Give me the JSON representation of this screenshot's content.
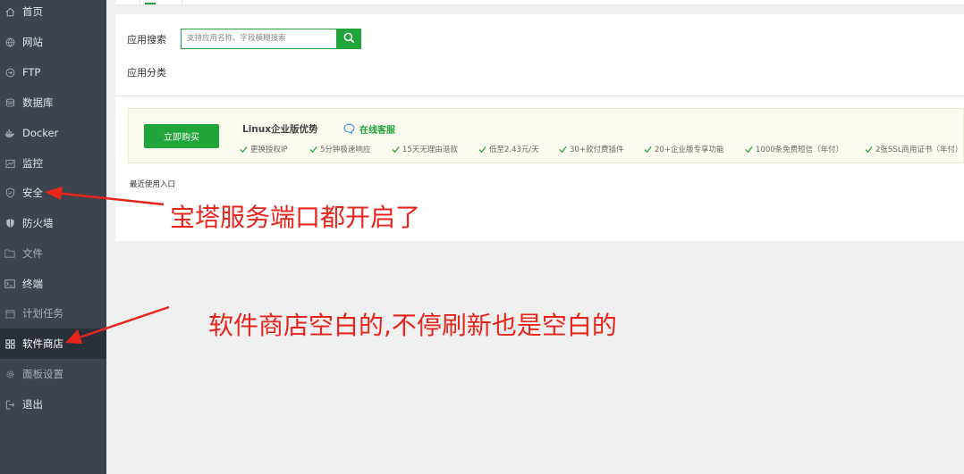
{
  "sidebar": {
    "items": [
      {
        "label": "首页",
        "icon": "home-icon"
      },
      {
        "label": "网站",
        "icon": "globe-icon"
      },
      {
        "label": "FTP",
        "icon": "ftp-icon"
      },
      {
        "label": "数据库",
        "icon": "database-icon"
      },
      {
        "label": "Docker",
        "icon": "docker-icon"
      },
      {
        "label": "监控",
        "icon": "monitor-icon"
      },
      {
        "label": "安全",
        "icon": "shield-icon"
      },
      {
        "label": "防火墙",
        "icon": "firewall-icon"
      },
      {
        "label": "文件",
        "icon": "folder-icon"
      },
      {
        "label": "终端",
        "icon": "terminal-icon"
      },
      {
        "label": "计划任务",
        "icon": "calendar-icon"
      },
      {
        "label": "软件商店",
        "icon": "grid-icon"
      },
      {
        "label": "面板设置",
        "icon": "gear-icon"
      },
      {
        "label": "退出",
        "icon": "logout-icon"
      }
    ],
    "active_index": 11
  },
  "search": {
    "label": "应用搜索",
    "placeholder": "支持应用名称、字段模糊搜索"
  },
  "category": {
    "label": "应用分类"
  },
  "promo": {
    "buy_label": "立即购买",
    "title": "Linux企业版优势",
    "service_label": "在线客服",
    "features": [
      "更换授权IP",
      "5分钟极速响应",
      "15天无理由退款",
      "低至2.43元/天",
      "30+款付费插件",
      "20+企业版专享功能",
      "1000条免费短信（年付）",
      "2张SSL商用证书（年付）"
    ]
  },
  "recent": {
    "label": "最近使用入口"
  },
  "annotations": {
    "first": "宝塔服务端口都开启了",
    "second": "软件商店空白的,不停刷新也是空白的"
  },
  "colors": {
    "accent": "#20a53a",
    "sidebar_bg": "#3c444d",
    "annotation": "#e8251c"
  }
}
